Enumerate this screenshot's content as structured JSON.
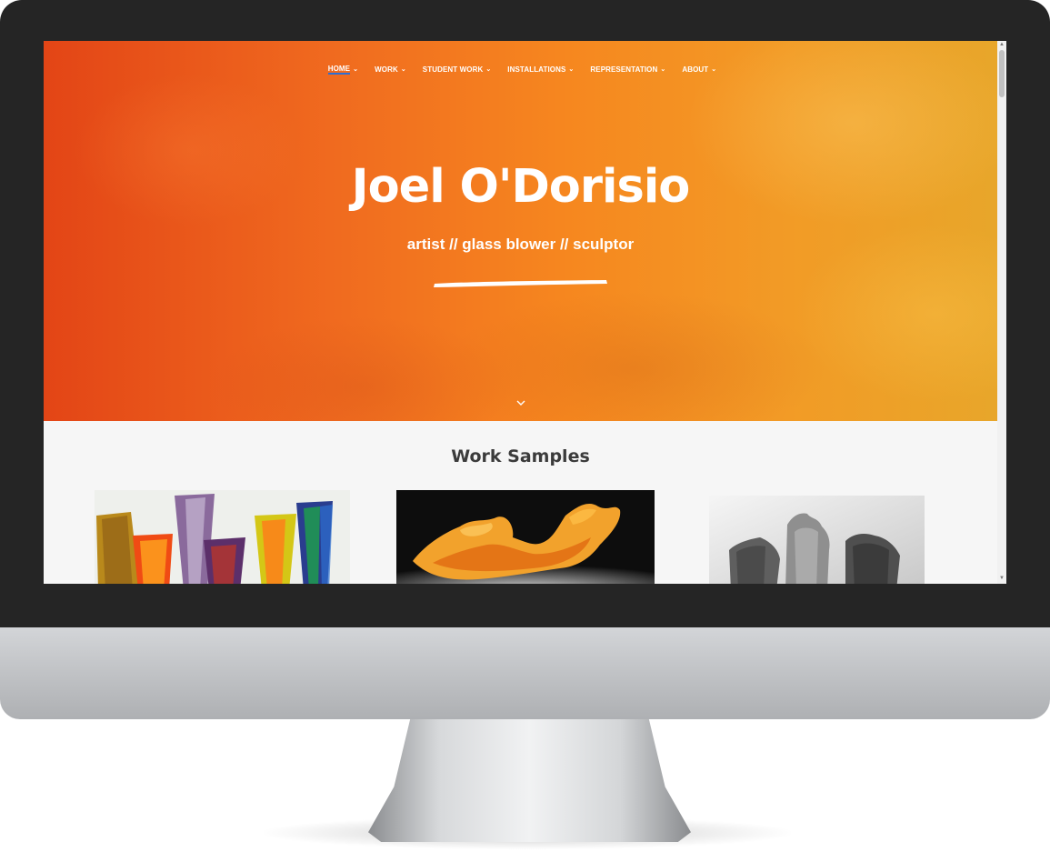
{
  "site": {
    "nav": {
      "items": [
        {
          "label": "HOME",
          "active": true
        },
        {
          "label": "WORK",
          "active": false
        },
        {
          "label": "STUDENT WORK",
          "active": false
        },
        {
          "label": "INSTALLATIONS",
          "active": false
        },
        {
          "label": "REPRESENTATION",
          "active": false
        },
        {
          "label": "ABOUT",
          "active": false
        }
      ],
      "chevron_icon": "chevron-down-icon",
      "active_color": "#2a6fd6"
    },
    "hero": {
      "title": "Joel O'Dorisio",
      "subtitle": "artist // glass blower // sculptor",
      "scroll_icon": "chevron-down-icon",
      "gradient_colors": [
        "#e34516",
        "#f6871f",
        "#e8a62a"
      ]
    },
    "work_samples": {
      "title": "Work Samples",
      "images": [
        {
          "subject": "colorful glass vessels"
        },
        {
          "subject": "orange glass sculpture"
        },
        {
          "subject": "grey glass panels"
        }
      ]
    }
  }
}
